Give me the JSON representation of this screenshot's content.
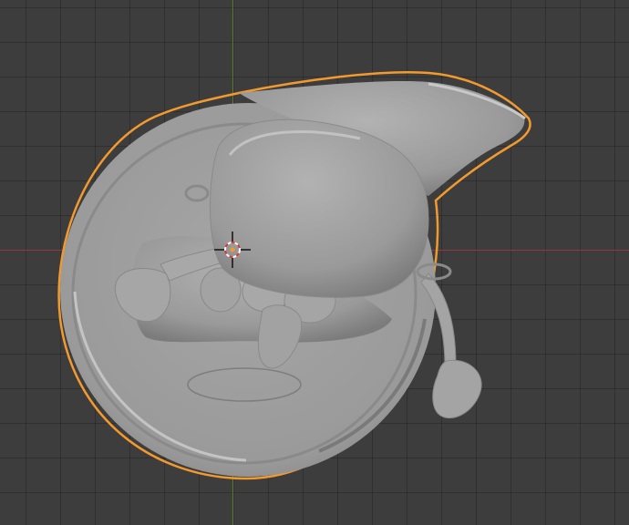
{
  "viewport": {
    "background_color": "#3d3d3d",
    "grid_line_color": "#333333",
    "x_axis_color": "#8f3a3f",
    "y_axis_color": "#5c7a2a"
  },
  "selection": {
    "outline_color": "#f39a2e",
    "object_color": "#9d9d9d"
  },
  "cursor_3d": {
    "icon": "3d-cursor-icon",
    "ring_color_a": "#ffffff",
    "ring_color_b": "#d73c3c",
    "crosshair_color": "#111111"
  }
}
